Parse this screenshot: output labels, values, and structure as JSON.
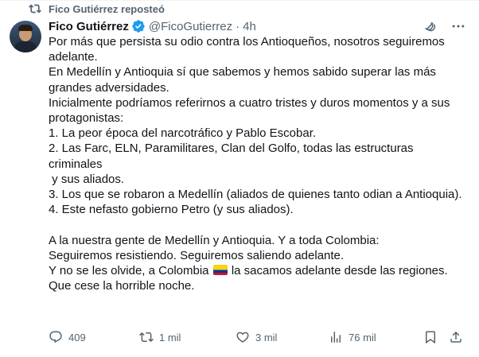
{
  "repost": {
    "text": "Fico Gutiérrez reposteó",
    "icon": "repost-icon"
  },
  "author": {
    "name": "Fico Gutiérrez",
    "handle": "@FicoGutierrez",
    "separator": "·",
    "time": "4h",
    "verified_color": "#1d9bf0"
  },
  "body_lines": [
    "Por más que persista su odio contra los Antioqueños, nosotros seguiremos adelante.",
    "En Medellín y Antioquia sí que sabemos y hemos sabido superar las más grandes adversidades.",
    "Inicialmente podríamos referirnos a cuatro tristes y duros momentos y a sus protagonistas:",
    "1. La peor época del narcotráfico y Pablo Escobar.",
    "2. Las Farc, ELN, Paramilitares, Clan del Golfo, todas las estructuras criminales",
    " y sus aliados.",
    "3. Los que se robaron a Medellín (aliados de quienes tanto odian a Antioquia).",
    "4. Este nefasto gobierno Petro (y sus aliados).",
    "",
    "A la nuestra gente de Medellín y Antioquia. Y a toda Colombia:",
    "Seguiremos resistiendo. Seguiremos saliendo adelante."
  ],
  "flag_line": {
    "before": "Y no se les olvide, a Colombia ",
    "after": " la sacamos adelante desde las regiones."
  },
  "last_line": "Que cese la horrible noche.",
  "actions": {
    "replies": "409",
    "reposts": "1 mil",
    "likes": "3 mil",
    "views": "76 mil"
  },
  "colors": {
    "text": "#0f1419",
    "secondary": "#536471",
    "accent": "#1d9bf0"
  }
}
